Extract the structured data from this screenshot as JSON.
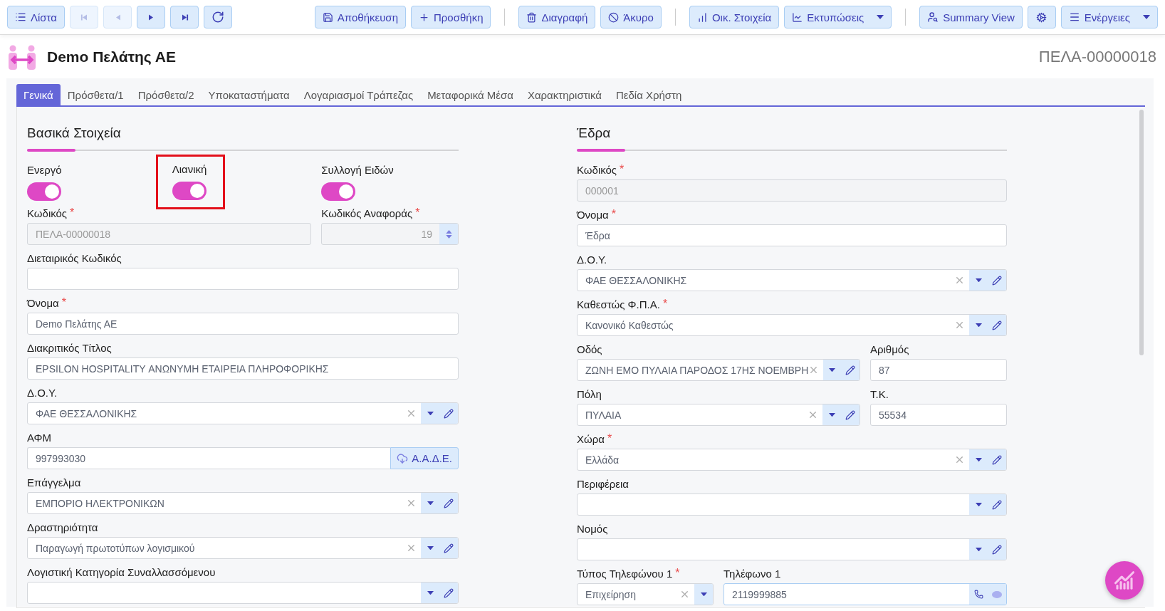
{
  "toolbar": {
    "nav": [
      {
        "label": "Λίστα",
        "disabled": false
      },
      {
        "disabled": true
      },
      {
        "disabled": true
      },
      {
        "disabled": false
      },
      {
        "disabled": false
      },
      {
        "disabled": false
      }
    ],
    "groups": [
      [
        {
          "label": "Αποθήκευση",
          "dropdown": false
        },
        {
          "label": "Προσθήκη",
          "dropdown": false
        }
      ],
      [
        {
          "label": "Διαγραφή",
          "dropdown": false
        },
        {
          "label": "Άκυρο",
          "dropdown": false
        }
      ],
      [
        {
          "label": "Οικ. Στοιχεία",
          "dropdown": false
        },
        {
          "label": "Εκτυπώσεις",
          "dropdown": true
        }
      ],
      [
        {
          "label": "Summary View",
          "dropdown": false
        },
        {
          "dropdown": false
        },
        {
          "label": "Ενέργειες",
          "dropdown": true
        }
      ]
    ]
  },
  "header": {
    "title": "Demo Πελάτης ΑΕ",
    "code": "ΠΕΛΑ-00000018"
  },
  "tabs": [
    {
      "label": "Γενικά",
      "selected": true
    },
    {
      "label": "Πρόσθετα/1",
      "selected": false
    },
    {
      "label": "Πρόσθετα/2",
      "selected": false
    },
    {
      "label": "Υποκαταστήματα",
      "selected": false
    },
    {
      "label": "Λογαριασμοί Τράπεζας",
      "selected": false
    },
    {
      "label": "Μεταφορικά Μέσα",
      "selected": false
    },
    {
      "label": "Χαρακτηριστικά",
      "selected": false
    },
    {
      "label": "Πεδία Χρήστη",
      "selected": false
    }
  ],
  "sections": [
    {
      "title": "Βασικά Στοιχεία",
      "toggles": [
        {
          "label": "Ενεργό",
          "on": true,
          "highlighted": false
        },
        {
          "label": "Λιανική",
          "on": true,
          "highlighted": true
        },
        {
          "label": "Συλλογή Ειδών",
          "on": true,
          "highlighted": false
        }
      ],
      "rows": [
        [
          {
            "kind": "text",
            "label": "Κωδικός",
            "mark": "*",
            "value": "ΠΕΛΑ-00000018",
            "disabled": true
          },
          {
            "kind": "number",
            "label": "Κωδικός Αναφοράς",
            "mark": "*",
            "value": "19",
            "disabled": true
          }
        ],
        [
          {
            "kind": "text",
            "label": "Διεταιρικός Κωδικός",
            "disabled": false
          }
        ],
        [
          {
            "kind": "text",
            "label": "Όνομα",
            "mark": "*",
            "value": "Demo Πελάτης ΑΕ",
            "disabled": false
          }
        ],
        [
          {
            "kind": "text",
            "label": "Διακριτικός Τίτλος",
            "value": "EPSILON HOSPITALITY ΑΝΩΝΥΜΗ ΕΤΑΙΡΕΙΑ ΠΛΗΡΟΦΟΡΙΚΗΣ",
            "disabled": false
          }
        ],
        [
          {
            "kind": "select",
            "label": "Δ.Ο.Υ.",
            "value": "ΦΑΕ ΘΕΣΣΑΛΟΝΙΚΗΣ",
            "editable": true
          }
        ],
        [
          {
            "kind": "afm",
            "label": "ΑΦΜ",
            "value": "997993030",
            "button": "Α.Α.Δ.Ε."
          }
        ],
        [
          {
            "kind": "select",
            "label": "Επάγγελμα",
            "value": "ΕΜΠΟΡΙΟ ΗΛΕΚΤΡΟΝΙΚΩΝ",
            "editable": true
          }
        ],
        [
          {
            "kind": "select",
            "label": "Δραστηριότητα",
            "value": "Παραγωγή πρωτοτύπων λογισμικού",
            "editable": true
          }
        ],
        [
          {
            "kind": "select",
            "label": "Λογιστική Κατηγορία Συναλλασσόμενου",
            "editable": true
          }
        ]
      ]
    },
    {
      "title": "Έδρα",
      "rows": [
        [
          {
            "kind": "text",
            "label": "Κωδικός",
            "mark": "*",
            "value": "000001",
            "disabled": true
          }
        ],
        [
          {
            "kind": "text",
            "label": "Όνομα",
            "mark": "*",
            "value": "Έδρα",
            "disabled": false
          }
        ],
        [
          {
            "kind": "select",
            "label": "Δ.Ο.Υ.",
            "value": "ΦΑΕ ΘΕΣΣΑΛΟΝΙΚΗΣ",
            "editable": true
          }
        ],
        [
          {
            "kind": "select",
            "label": "Καθεστώς Φ.Π.Α.",
            "mark": "*",
            "value": "Κανονικό Καθεστώς",
            "editable": true
          }
        ],
        [
          {
            "kind": "select",
            "label": "Οδός",
            "value": "ΖΩΝΗ ΕΜΟ ΠΥΛΑΙΑ ΠΑΡΟΔΟΣ 17ΗΣ ΝΟΕΜΒΡΗ",
            "editable": true
          },
          {
            "kind": "text",
            "label": "Αριθμός",
            "value": "87",
            "disabled": false
          }
        ],
        [
          {
            "kind": "select",
            "label": "Πόλη",
            "value": "ΠΥΛΑΙΑ",
            "editable": true
          },
          {
            "kind": "text",
            "label": "Τ.Κ.",
            "value": "55534",
            "disabled": false
          }
        ],
        [
          {
            "kind": "select",
            "label": "Χώρα",
            "mark": "*",
            "value": "Ελλάδα",
            "editable": true
          }
        ],
        [
          {
            "kind": "select",
            "label": "Περιφέρεια",
            "editable": true
          }
        ],
        [
          {
            "kind": "select",
            "label": "Νομός",
            "editable": true
          }
        ],
        [
          {
            "kind": "select",
            "label": "Τύπος Τηλεφώνου 1",
            "mark": "*",
            "value": "Επιχείρηση",
            "editable": false
          },
          {
            "kind": "phone",
            "label": "Τηλέφωνο 1",
            "value": "2119999885"
          }
        ]
      ]
    }
  ]
}
